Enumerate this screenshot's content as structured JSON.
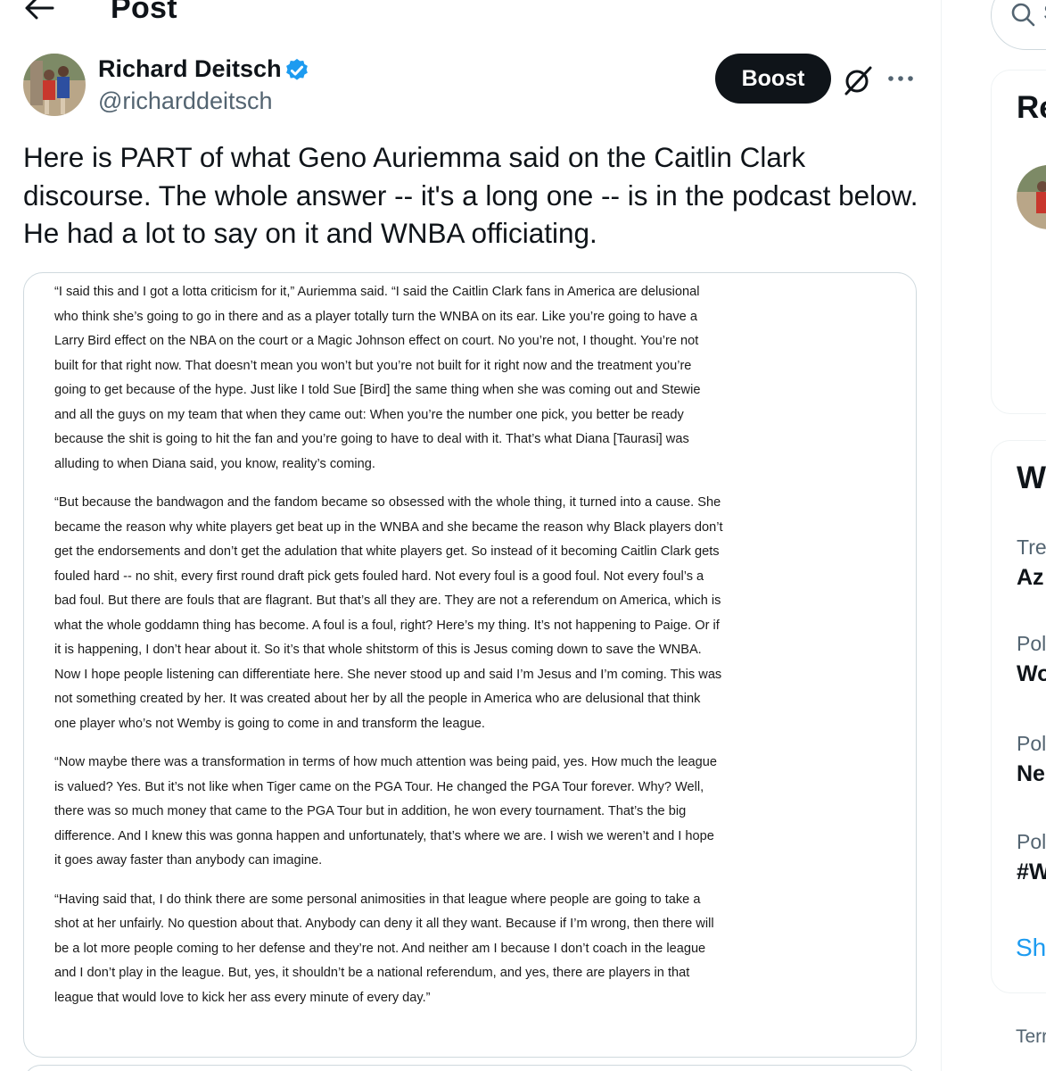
{
  "header": {
    "title": "Post",
    "back_icon": "arrow-left-icon"
  },
  "author": {
    "display_name": "Richard Deitsch",
    "handle": "@richarddeitsch",
    "verified": true,
    "verified_color": "#1d9bf0"
  },
  "actions": {
    "boost_label": "Boost",
    "grok_icon": "grok-icon",
    "more_icon": "more-icon"
  },
  "post": {
    "text": "Here is PART of what Geno Auriemma said on the Caitlin Clark discourse. The whole answer -- it's a long one -- is in the podcast below. He had a lot to say on it and WNBA officiating."
  },
  "media_text": [
    "“I said this and I got a lotta criticism for it,” Auriemma said. “I said the Caitlin Clark fans in America are delusional who think she’s going to go in there and as a player totally turn the WNBA on its ear. Like you’re going to have a Larry Bird effect on the NBA on the court or a Magic Johnson effect on court. No you’re not, I thought. You’re not built for that right now. That doesn’t mean you won’t but you’re not built for it right now and the treatment you’re going to get because of the hype. Just like I told Sue [Bird] the same thing when she was coming out and Stewie and all the guys on my team that when they came out: When you’re the number one pick, you better be ready because the shit is going to hit the fan and you’re going to have to deal with it. That’s what Diana [Taurasi] was alluding to when Diana said, you know, reality’s coming.",
    "“But because the bandwagon and the fandom became so obsessed with the whole thing, it turned into a cause. She became the reason why white players get beat up in the WNBA and she became the reason why Black players don’t get the endorsements and don’t get the adulation that white players get. So instead of it becoming Caitlin Clark gets fouled hard -- no shit, every first round draft pick gets fouled hard. Not every foul is a good foul. Not every foul’s a bad foul. But there are fouls that are flagrant. But that’s all they are. They are not a referendum on America, which is what the whole goddamn thing has become. A foul is a foul, right? Here’s my thing. It’s not happening to Paige. Or if it is happening, I don’t hear about it. So it’s that whole shitstorm of this is Jesus coming down to save the WNBA. Now I hope people listening can differentiate here. She never stood up and said I’m Jesus and I’m coming. This was not something created by her. It was created about her by all the people in America who are delusional that think one player who’s not Wemby is going to come in and transform the league.",
    "“Now maybe there was a transformation in terms of how much attention was being paid, yes. How much the league is valued? Yes. But it’s not like when Tiger came on the PGA Tour. He changed the PGA Tour forever. Why? Well, there was so much money that came to the PGA Tour but in addition, he won every tournament. That’s the big difference. And I knew this was gonna happen and unfortunately, that’s where we are. I wish we weren’t and I hope it goes away faster than anybody can imagine.",
    "“Having said that, I do think there are some personal animosities in that league where people are going to take a shot at her unfairly. No question about that. Anybody can deny it all they want. Because if I’m wrong, then there will be a lot more people coming to her defense and they’re not. And neither am I because I don’t coach in the league and I don’t play in the league. But, yes, it shouldn’t be a national referendum, and yes, there are players in that league that would love to kick her ass every minute of every day.”"
  ],
  "sidebar": {
    "search_placeholder": "S",
    "card1_title": "Re",
    "card2_title": "W",
    "trends": [
      {
        "meta": "Tre",
        "name": "Az"
      },
      {
        "meta": "Pol",
        "name": "Wo"
      },
      {
        "meta": "Pol",
        "name": "Ne"
      },
      {
        "meta": "Pol",
        "name": "#W"
      }
    ],
    "show_more": "Sh",
    "footer": "Terr"
  }
}
